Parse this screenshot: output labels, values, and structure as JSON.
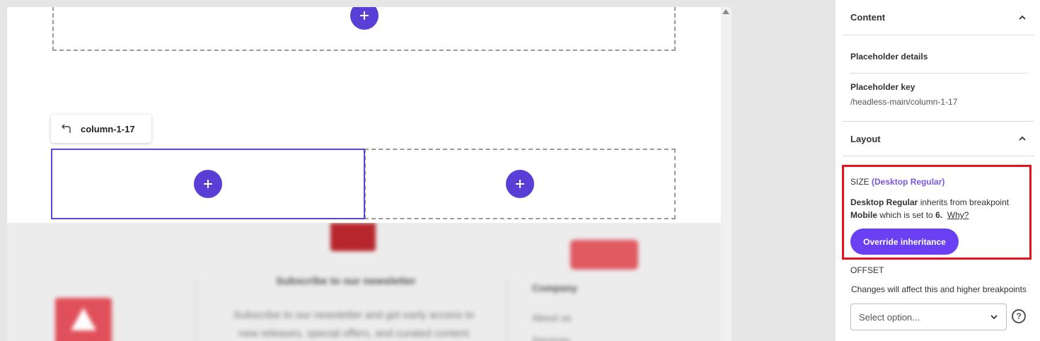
{
  "canvas": {
    "chip_label": "column-1-17",
    "footer": {
      "heading": "Subscribe to our newsletter",
      "paragraph": "Subscribe to our newsletter and get early access to new releases, special offers, and curated content",
      "column_title": "Company",
      "links": [
        "About us",
        "Services"
      ]
    }
  },
  "panel": {
    "content_section": {
      "title": "Content"
    },
    "placeholder_details": {
      "label": "Placeholder details"
    },
    "placeholder_key": {
      "label": "Placeholder key",
      "value": "/headless-main/column-1-17"
    },
    "layout_section": {
      "title": "Layout"
    },
    "size": {
      "label": "SIZE",
      "breakpoint": "(Desktop Regular)",
      "inherit_bp": "Desktop Regular",
      "inherit_mid": "inherits from breakpoint",
      "inherit_from": "Mobile",
      "inherit_set": "which is set to",
      "inherit_value": "6.",
      "why_link": "Why?",
      "override_button": "Override inheritance"
    },
    "offset": {
      "label": "OFFSET",
      "help": "Changes will affect this and higher breakpoints",
      "select_placeholder": "Select option..."
    }
  },
  "colors": {
    "accent": "#5a3fd6",
    "button": "#6b3ff2",
    "highlight": "#e8121c",
    "breakpoint_text": "#7b55e6"
  }
}
